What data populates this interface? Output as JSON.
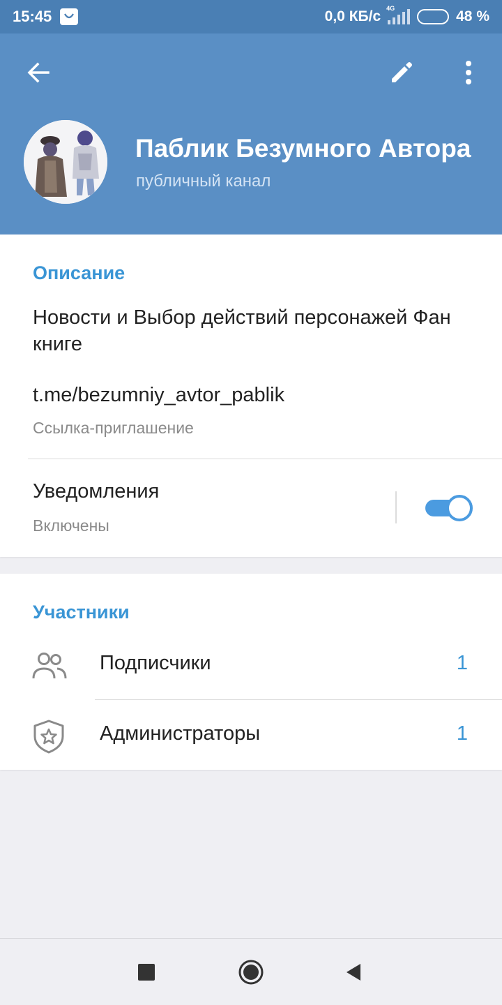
{
  "status_bar": {
    "time": "15:45",
    "network_speed": "0,0 КБ/с",
    "network_type": "4G",
    "battery_percent_label": "48 %",
    "battery_level": 0.48
  },
  "header": {
    "title": "Паблик Безумного Автора",
    "subtitle": "публичный канал",
    "icons": [
      "back-arrow-icon",
      "pencil-icon",
      "more-vert-icon"
    ]
  },
  "info": {
    "section_title": "Описание",
    "description": "Новости и Выбор действий персонажей Фан книге",
    "link": "t.me/bezumniy_avtor_pablik",
    "link_caption": "Ссылка-приглашение",
    "notifications_label": "Уведомления",
    "notifications_status": "Включены",
    "notifications_enabled": true
  },
  "members": {
    "section_title": "Участники",
    "items": [
      {
        "label": "Подписчики",
        "count": "1",
        "icon": "people-icon"
      },
      {
        "label": "Администраторы",
        "count": "1",
        "icon": "shield-star-icon"
      }
    ]
  },
  "colors": {
    "status_bar": "#4a7fb4",
    "header": "#5a8fc5",
    "accent": "#3a95d5",
    "toggle": "#4b9be0"
  }
}
